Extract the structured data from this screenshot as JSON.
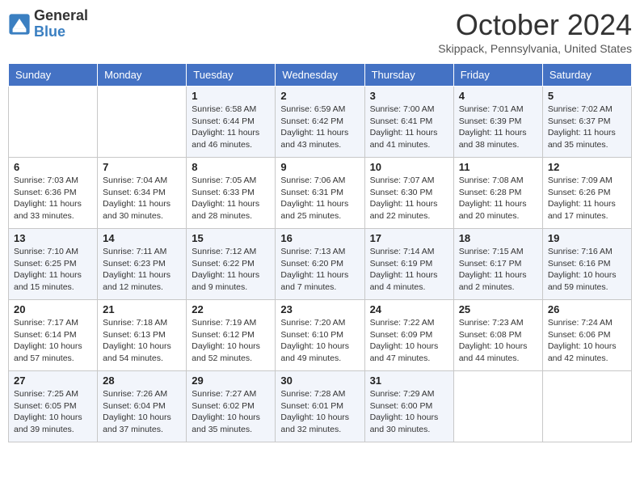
{
  "header": {
    "logo_general": "General",
    "logo_blue": "Blue",
    "month_title": "October 2024",
    "location": "Skippack, Pennsylvania, United States"
  },
  "weekdays": [
    "Sunday",
    "Monday",
    "Tuesday",
    "Wednesday",
    "Thursday",
    "Friday",
    "Saturday"
  ],
  "weeks": [
    [
      {
        "day": "",
        "sunrise": "",
        "sunset": "",
        "daylight": ""
      },
      {
        "day": "",
        "sunrise": "",
        "sunset": "",
        "daylight": ""
      },
      {
        "day": "1",
        "sunrise": "Sunrise: 6:58 AM",
        "sunset": "Sunset: 6:44 PM",
        "daylight": "Daylight: 11 hours and 46 minutes."
      },
      {
        "day": "2",
        "sunrise": "Sunrise: 6:59 AM",
        "sunset": "Sunset: 6:42 PM",
        "daylight": "Daylight: 11 hours and 43 minutes."
      },
      {
        "day": "3",
        "sunrise": "Sunrise: 7:00 AM",
        "sunset": "Sunset: 6:41 PM",
        "daylight": "Daylight: 11 hours and 41 minutes."
      },
      {
        "day": "4",
        "sunrise": "Sunrise: 7:01 AM",
        "sunset": "Sunset: 6:39 PM",
        "daylight": "Daylight: 11 hours and 38 minutes."
      },
      {
        "day": "5",
        "sunrise": "Sunrise: 7:02 AM",
        "sunset": "Sunset: 6:37 PM",
        "daylight": "Daylight: 11 hours and 35 minutes."
      }
    ],
    [
      {
        "day": "6",
        "sunrise": "Sunrise: 7:03 AM",
        "sunset": "Sunset: 6:36 PM",
        "daylight": "Daylight: 11 hours and 33 minutes."
      },
      {
        "day": "7",
        "sunrise": "Sunrise: 7:04 AM",
        "sunset": "Sunset: 6:34 PM",
        "daylight": "Daylight: 11 hours and 30 minutes."
      },
      {
        "day": "8",
        "sunrise": "Sunrise: 7:05 AM",
        "sunset": "Sunset: 6:33 PM",
        "daylight": "Daylight: 11 hours and 28 minutes."
      },
      {
        "day": "9",
        "sunrise": "Sunrise: 7:06 AM",
        "sunset": "Sunset: 6:31 PM",
        "daylight": "Daylight: 11 hours and 25 minutes."
      },
      {
        "day": "10",
        "sunrise": "Sunrise: 7:07 AM",
        "sunset": "Sunset: 6:30 PM",
        "daylight": "Daylight: 11 hours and 22 minutes."
      },
      {
        "day": "11",
        "sunrise": "Sunrise: 7:08 AM",
        "sunset": "Sunset: 6:28 PM",
        "daylight": "Daylight: 11 hours and 20 minutes."
      },
      {
        "day": "12",
        "sunrise": "Sunrise: 7:09 AM",
        "sunset": "Sunset: 6:26 PM",
        "daylight": "Daylight: 11 hours and 17 minutes."
      }
    ],
    [
      {
        "day": "13",
        "sunrise": "Sunrise: 7:10 AM",
        "sunset": "Sunset: 6:25 PM",
        "daylight": "Daylight: 11 hours and 15 minutes."
      },
      {
        "day": "14",
        "sunrise": "Sunrise: 7:11 AM",
        "sunset": "Sunset: 6:23 PM",
        "daylight": "Daylight: 11 hours and 12 minutes."
      },
      {
        "day": "15",
        "sunrise": "Sunrise: 7:12 AM",
        "sunset": "Sunset: 6:22 PM",
        "daylight": "Daylight: 11 hours and 9 minutes."
      },
      {
        "day": "16",
        "sunrise": "Sunrise: 7:13 AM",
        "sunset": "Sunset: 6:20 PM",
        "daylight": "Daylight: 11 hours and 7 minutes."
      },
      {
        "day": "17",
        "sunrise": "Sunrise: 7:14 AM",
        "sunset": "Sunset: 6:19 PM",
        "daylight": "Daylight: 11 hours and 4 minutes."
      },
      {
        "day": "18",
        "sunrise": "Sunrise: 7:15 AM",
        "sunset": "Sunset: 6:17 PM",
        "daylight": "Daylight: 11 hours and 2 minutes."
      },
      {
        "day": "19",
        "sunrise": "Sunrise: 7:16 AM",
        "sunset": "Sunset: 6:16 PM",
        "daylight": "Daylight: 10 hours and 59 minutes."
      }
    ],
    [
      {
        "day": "20",
        "sunrise": "Sunrise: 7:17 AM",
        "sunset": "Sunset: 6:14 PM",
        "daylight": "Daylight: 10 hours and 57 minutes."
      },
      {
        "day": "21",
        "sunrise": "Sunrise: 7:18 AM",
        "sunset": "Sunset: 6:13 PM",
        "daylight": "Daylight: 10 hours and 54 minutes."
      },
      {
        "day": "22",
        "sunrise": "Sunrise: 7:19 AM",
        "sunset": "Sunset: 6:12 PM",
        "daylight": "Daylight: 10 hours and 52 minutes."
      },
      {
        "day": "23",
        "sunrise": "Sunrise: 7:20 AM",
        "sunset": "Sunset: 6:10 PM",
        "daylight": "Daylight: 10 hours and 49 minutes."
      },
      {
        "day": "24",
        "sunrise": "Sunrise: 7:22 AM",
        "sunset": "Sunset: 6:09 PM",
        "daylight": "Daylight: 10 hours and 47 minutes."
      },
      {
        "day": "25",
        "sunrise": "Sunrise: 7:23 AM",
        "sunset": "Sunset: 6:08 PM",
        "daylight": "Daylight: 10 hours and 44 minutes."
      },
      {
        "day": "26",
        "sunrise": "Sunrise: 7:24 AM",
        "sunset": "Sunset: 6:06 PM",
        "daylight": "Daylight: 10 hours and 42 minutes."
      }
    ],
    [
      {
        "day": "27",
        "sunrise": "Sunrise: 7:25 AM",
        "sunset": "Sunset: 6:05 PM",
        "daylight": "Daylight: 10 hours and 39 minutes."
      },
      {
        "day": "28",
        "sunrise": "Sunrise: 7:26 AM",
        "sunset": "Sunset: 6:04 PM",
        "daylight": "Daylight: 10 hours and 37 minutes."
      },
      {
        "day": "29",
        "sunrise": "Sunrise: 7:27 AM",
        "sunset": "Sunset: 6:02 PM",
        "daylight": "Daylight: 10 hours and 35 minutes."
      },
      {
        "day": "30",
        "sunrise": "Sunrise: 7:28 AM",
        "sunset": "Sunset: 6:01 PM",
        "daylight": "Daylight: 10 hours and 32 minutes."
      },
      {
        "day": "31",
        "sunrise": "Sunrise: 7:29 AM",
        "sunset": "Sunset: 6:00 PM",
        "daylight": "Daylight: 10 hours and 30 minutes."
      },
      {
        "day": "",
        "sunrise": "",
        "sunset": "",
        "daylight": ""
      },
      {
        "day": "",
        "sunrise": "",
        "sunset": "",
        "daylight": ""
      }
    ]
  ]
}
